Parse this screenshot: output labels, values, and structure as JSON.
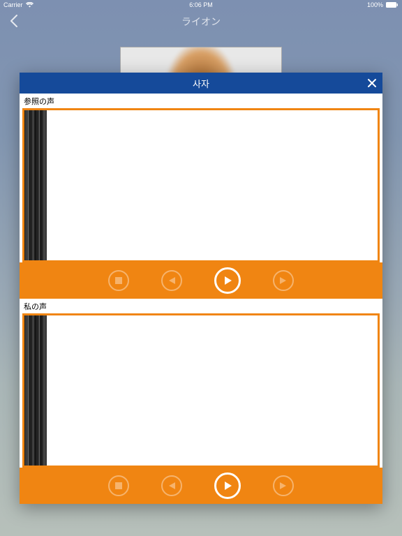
{
  "status": {
    "carrier": "Carrier",
    "time": "6:06 PM",
    "battery": "100%"
  },
  "nav": {
    "title": "ライオン"
  },
  "dialog": {
    "title": "사자",
    "sections": {
      "reference": {
        "label": "参照の声"
      },
      "mine": {
        "label": "私の声"
      }
    }
  },
  "icons": {
    "stop": "stop",
    "prev": "prev",
    "play": "play",
    "next": "next"
  }
}
